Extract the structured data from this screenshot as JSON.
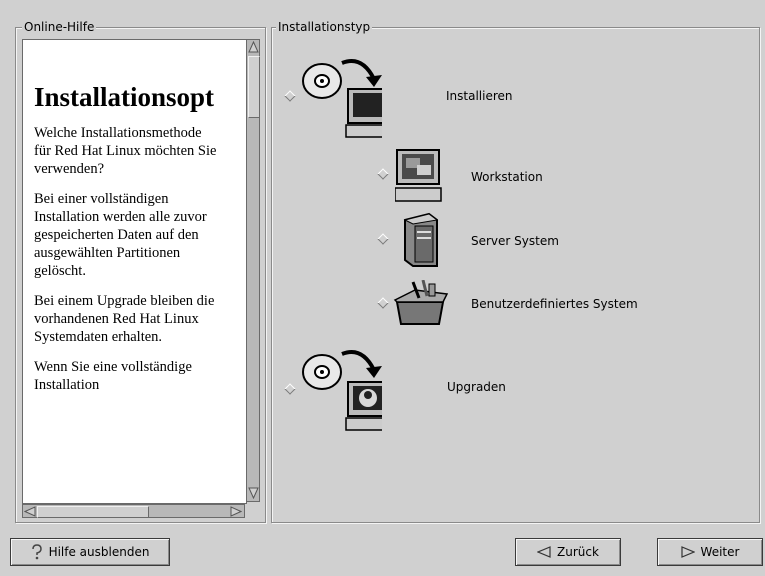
{
  "help": {
    "title": "Online-Hilfe",
    "heading": "Installationsopt",
    "paragraphs": [
      "Welche Installationsmethode für Red Hat Linux möchten Sie verwenden?",
      "Bei einer vollständigen Installation werden alle zuvor gespeicherten Daten auf den ausgewählten Partitionen gelöscht.",
      "Bei einem Upgrade bleiben die vorhandenen Red Hat Linux Systemdaten erhalten.",
      "Wenn Sie eine vollständige Installation"
    ]
  },
  "install": {
    "title": "Installationstyp",
    "install_label": "Installieren",
    "options": {
      "workstation": "Workstation",
      "server": "Server System",
      "custom": "Benutzerdefiniertes System"
    },
    "upgrade_label": "Upgraden"
  },
  "buttons": {
    "hide_help": "Hilfe ausblenden",
    "back": "Zurück",
    "next": "Weiter"
  },
  "icons": {
    "help": "question-icon",
    "back": "left-triangle-icon",
    "next": "right-triangle-icon"
  }
}
